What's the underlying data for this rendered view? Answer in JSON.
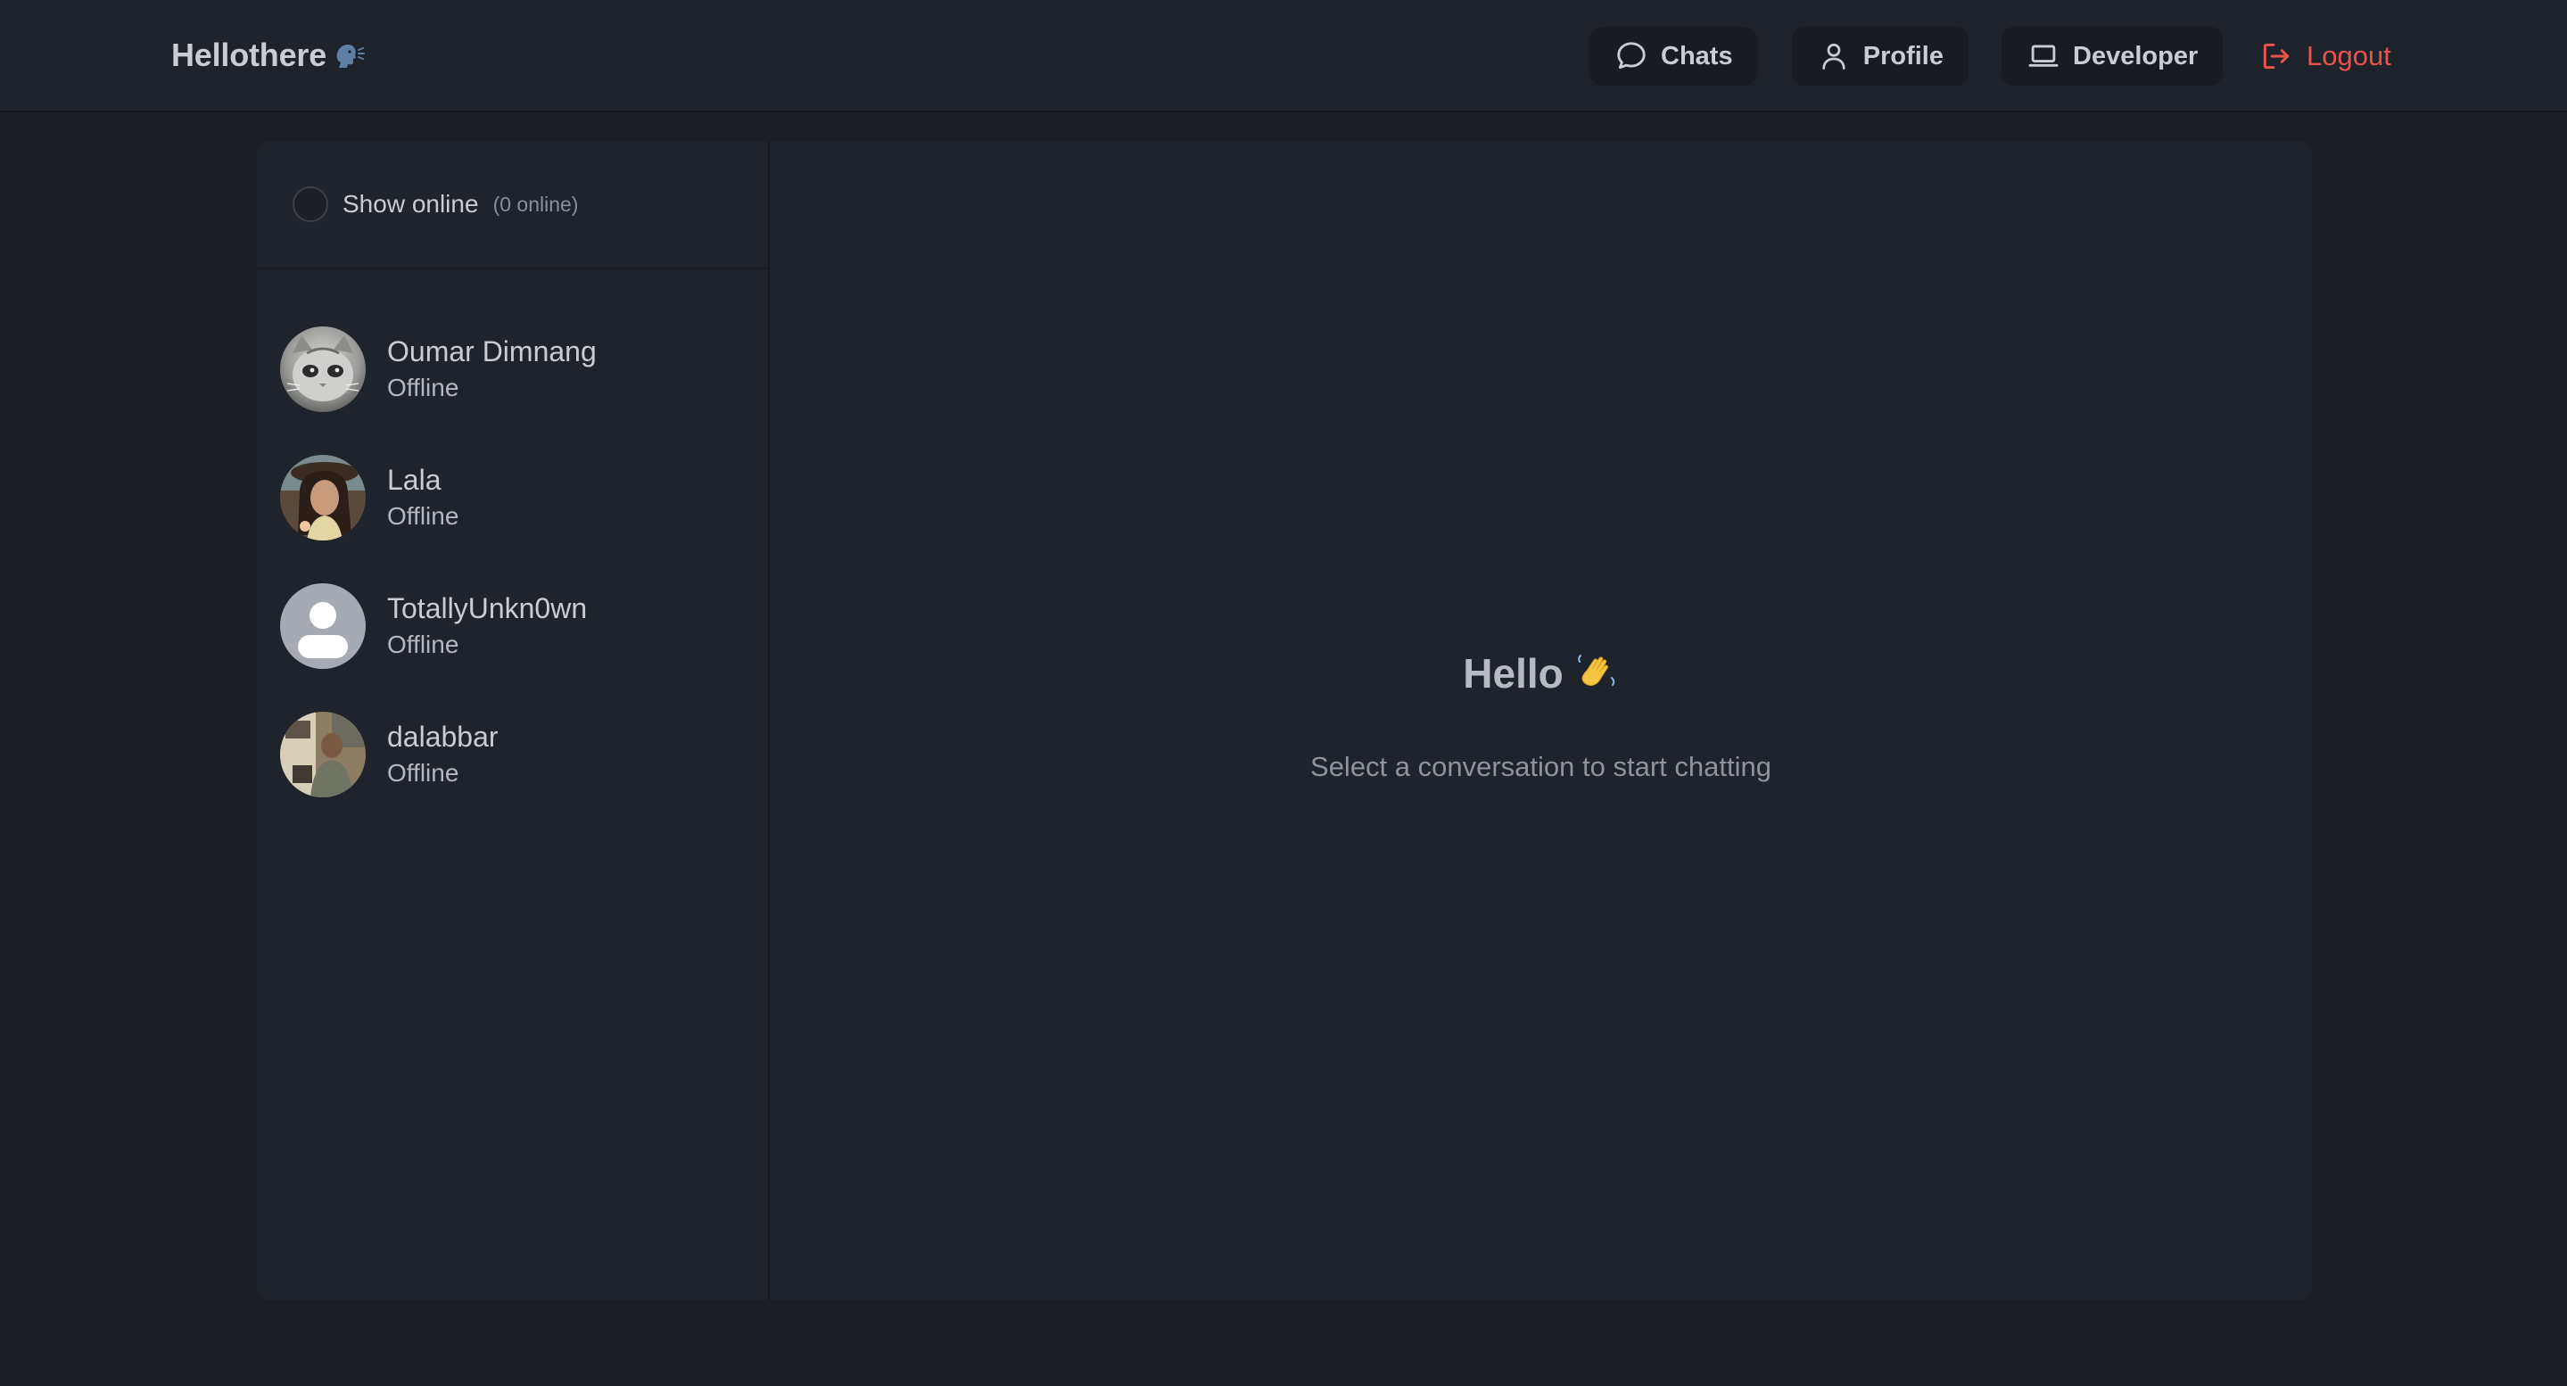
{
  "header": {
    "brand": "Hellothere",
    "brand_icon": "speaking-head-icon",
    "nav": {
      "chats_label": "Chats",
      "chats_icon": "chat-bubble-icon",
      "profile_label": "Profile",
      "profile_icon": "user-icon",
      "developer_label": "Developer",
      "developer_icon": "laptop-icon",
      "logout_label": "Logout",
      "logout_icon": "logout-icon"
    }
  },
  "sidebar": {
    "filter": {
      "label": "Show online",
      "count_text": "(0 online)",
      "checked": false
    },
    "contacts": [
      {
        "name": "Oumar Dimnang",
        "status": "Offline",
        "avatar": "cat-photo-avatar"
      },
      {
        "name": "Lala",
        "status": "Offline",
        "avatar": "person-photo-avatar"
      },
      {
        "name": "TotallyUnkn0wn",
        "status": "Offline",
        "avatar": "default-user-avatar"
      },
      {
        "name": "dalabbar",
        "status": "Offline",
        "avatar": "person-photo-avatar"
      }
    ]
  },
  "welcome": {
    "title": "Hello",
    "title_icon": "waving-hand-icon",
    "subtitle": "Select a conversation to start chatting"
  },
  "colors": {
    "background": "#1b1e24",
    "header": "#1e222a",
    "card": "#1f232b",
    "logout_red": "#e8534b",
    "text": "#c9ccd3",
    "muted": "#8f939b"
  }
}
